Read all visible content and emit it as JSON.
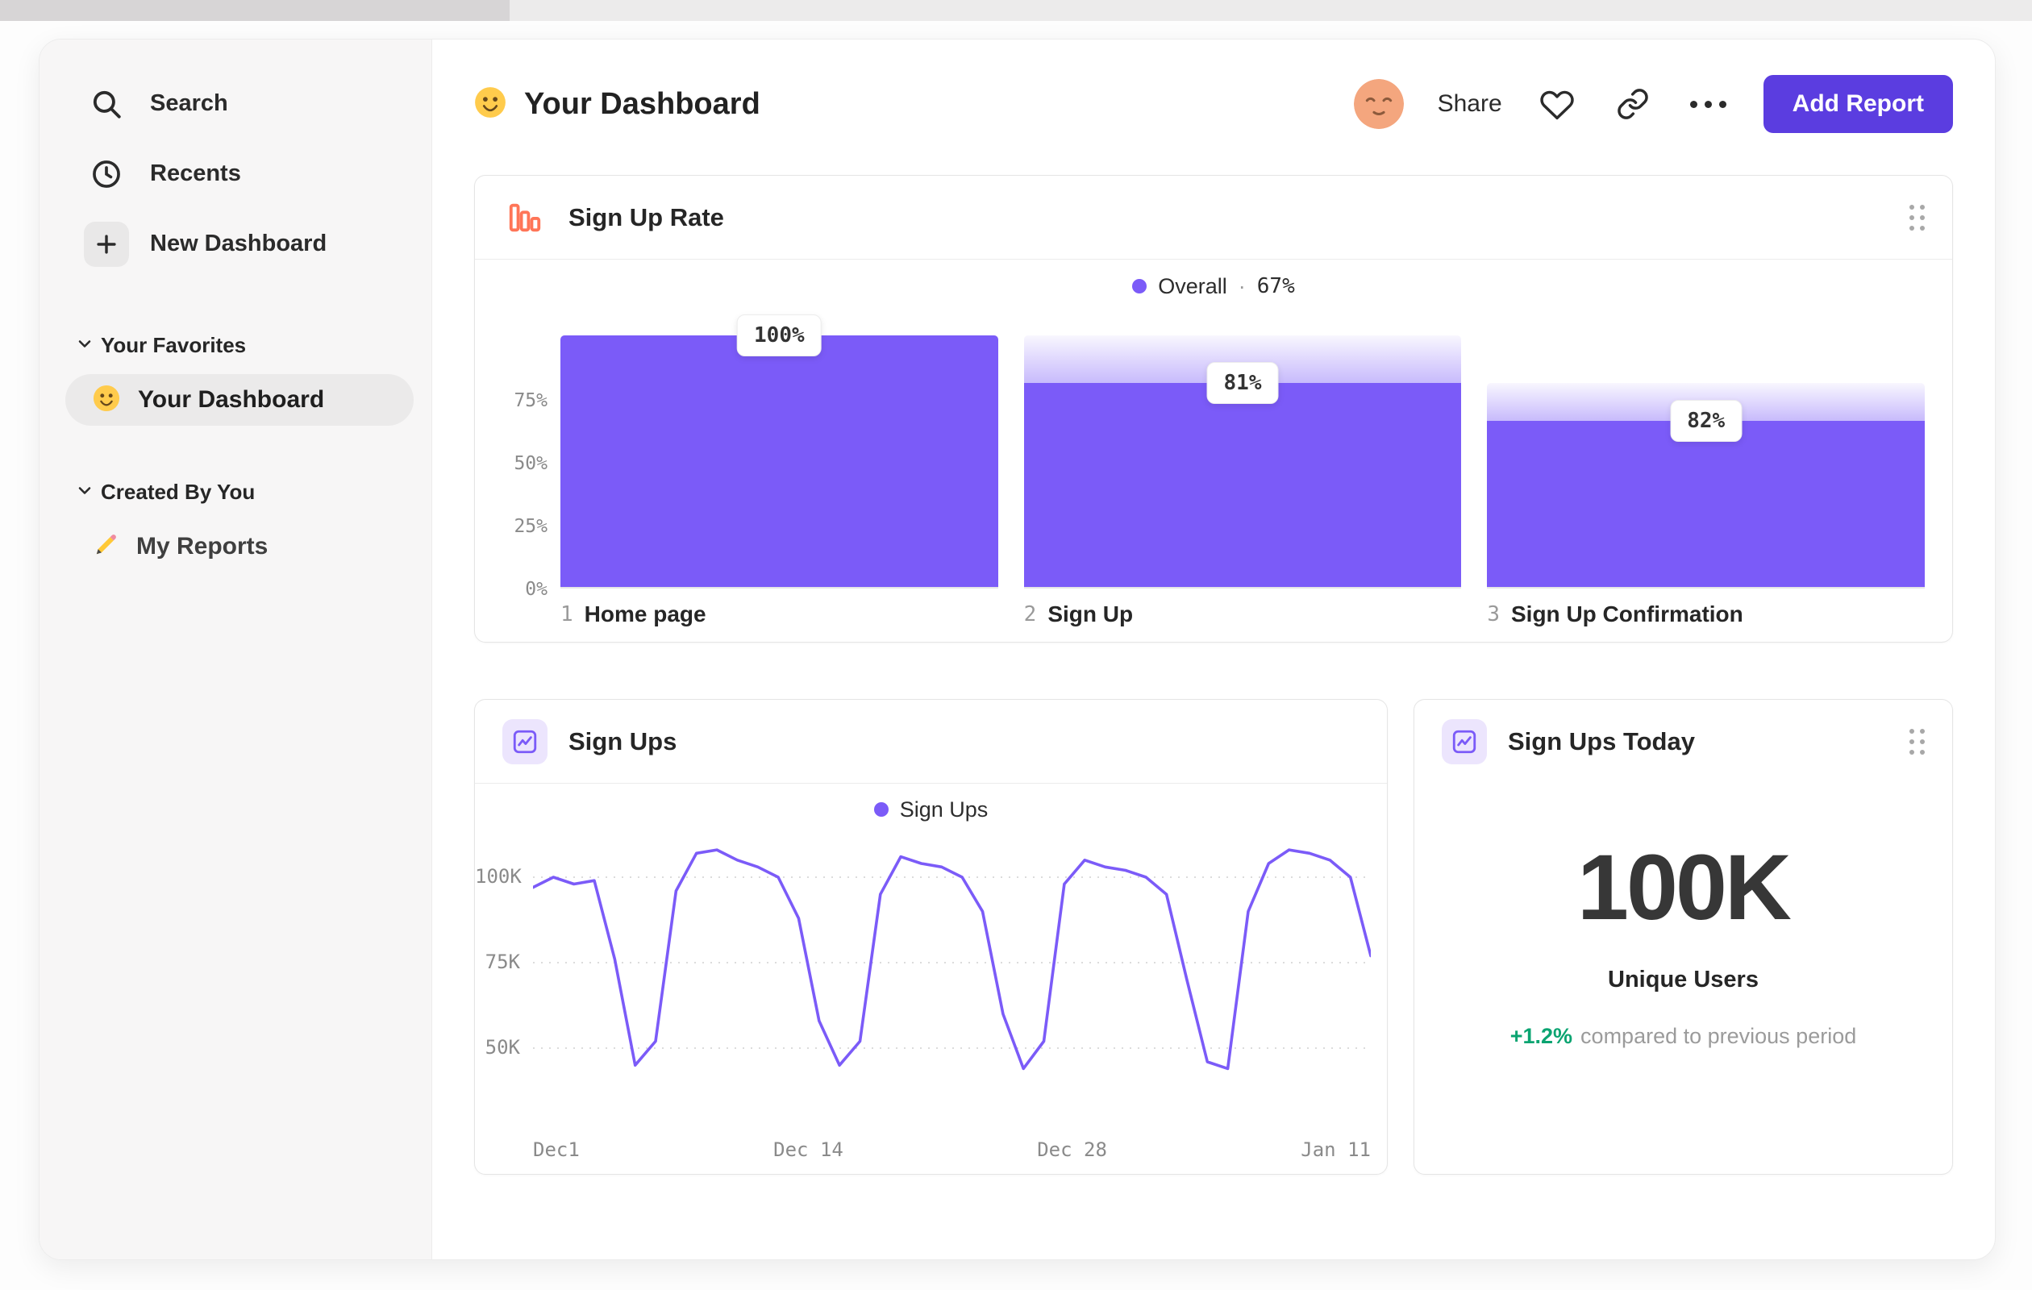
{
  "sidebar": {
    "items": [
      {
        "label": "Search"
      },
      {
        "label": "Recents"
      },
      {
        "label": "New Dashboard"
      }
    ],
    "sections": [
      {
        "label": "Your Favorites",
        "items": [
          {
            "label": "Your Dashboard"
          }
        ]
      },
      {
        "label": "Created By You",
        "items": [
          {
            "label": "My Reports"
          }
        ]
      }
    ]
  },
  "header": {
    "title": "Your Dashboard",
    "share_label": "Share",
    "add_report_label": "Add Report"
  },
  "cards": {
    "today": {
      "title": "Sign Ups Today",
      "value": "100K",
      "metric_label": "Unique Users",
      "delta": "+1.2%",
      "delta_text": "compared to previous period"
    }
  },
  "colors": {
    "accent_purple": "#7B5BF8",
    "accent_orange": "#FF7557",
    "button_purple": "#5B3DE0",
    "positive_green": "#0BA471"
  },
  "chart_data": [
    {
      "type": "bar",
      "title": "Sign Up Rate",
      "legend": "Overall",
      "legend_sep": "·",
      "overall_label": "67%",
      "overall_pct": 67,
      "step_numbers": [
        "1",
        "2",
        "3"
      ],
      "categories": [
        "Home page",
        "Sign Up",
        "Sign Up Confirmation"
      ],
      "values_pct": [
        100,
        81,
        82
      ],
      "value_labels": [
        "100%",
        "81%",
        "82%"
      ],
      "cumulative_pct": [
        100,
        81,
        66
      ],
      "y_ticks": [
        "75%",
        "50%",
        "25%",
        "0%"
      ],
      "y_tick_values": [
        75,
        50,
        25,
        0
      ],
      "ylim": [
        0,
        100
      ],
      "bar_color": "#7B5BF8"
    },
    {
      "type": "line",
      "title": "Sign Ups",
      "legend": "Sign Ups",
      "x_ticks": [
        "Dec1",
        "Dec 14",
        "Dec 28",
        "Jan 11"
      ],
      "y_ticks": [
        "100K",
        "75K",
        "50K"
      ],
      "y_tick_values": [
        100,
        75,
        50
      ],
      "x_range_days": 42,
      "values_k": [
        97,
        100,
        98,
        99,
        76,
        45,
        52,
        96,
        107,
        108,
        105,
        103,
        100,
        88,
        58,
        45,
        52,
        95,
        106,
        104,
        103,
        100,
        90,
        60,
        44,
        52,
        98,
        105,
        103,
        102,
        100,
        95,
        70,
        46,
        44,
        90,
        104,
        108,
        107,
        105,
        100,
        77
      ],
      "line_color": "#7B5BF8",
      "grid": "dashed-horizontal",
      "legend_position": "top-center"
    }
  ]
}
